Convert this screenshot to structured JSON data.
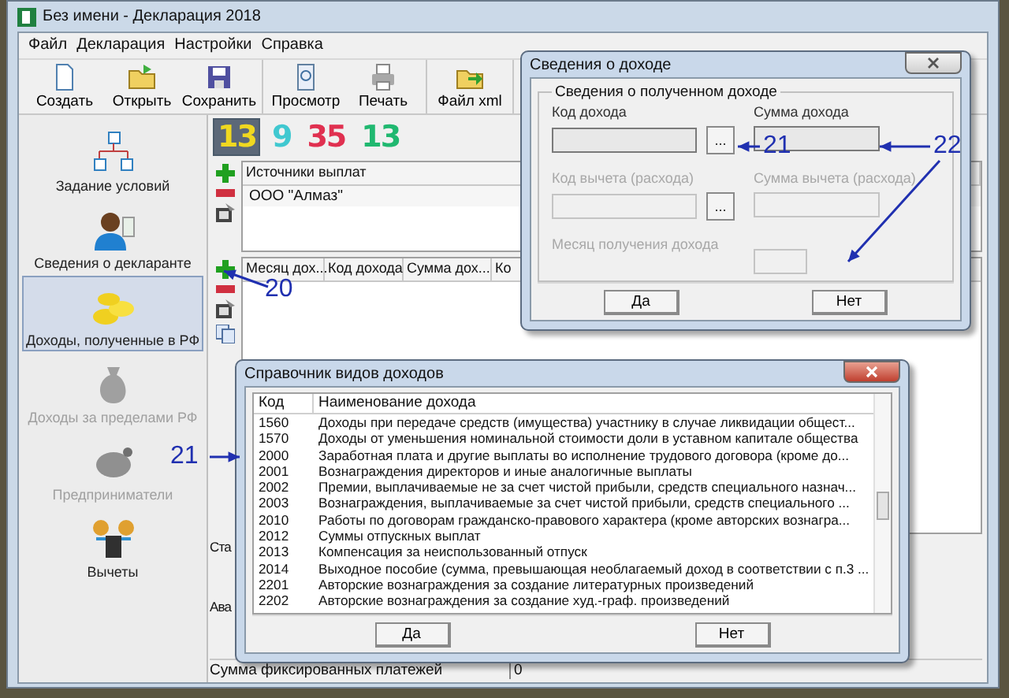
{
  "window": {
    "title": "Без имени - Декларация 2018"
  },
  "menu": [
    "Файл",
    "Декларация",
    "Настройки",
    "Справка"
  ],
  "toolbar": [
    [
      {
        "label": "Создать",
        "kind": "new"
      },
      {
        "label": "Открыть",
        "kind": "open"
      },
      {
        "label": "Сохранить",
        "kind": "save"
      }
    ],
    [
      {
        "label": "Просмотр",
        "kind": "preview"
      },
      {
        "label": "Печать",
        "kind": "print"
      }
    ],
    [
      {
        "label": "Файл xml",
        "kind": "xml"
      }
    ]
  ],
  "counters": [
    {
      "value": "13",
      "color": "#f0d820",
      "selected": true
    },
    {
      "value": "9",
      "color": "#40c8d0",
      "selected": false
    },
    {
      "value": "35",
      "color": "#e03050",
      "selected": false
    },
    {
      "value": "13",
      "color": "#20b870",
      "selected": false
    }
  ],
  "sidebar": [
    {
      "label": "Задание условий",
      "kind": "tree",
      "selected": false,
      "disabled": false
    },
    {
      "label": "Сведения о декларанте",
      "kind": "person",
      "selected": false,
      "disabled": false
    },
    {
      "label": "Доходы, полученные в РФ",
      "kind": "coins",
      "selected": true,
      "disabled": false
    },
    {
      "label": "Доходы за пределами РФ",
      "kind": "moneybag",
      "selected": false,
      "disabled": true
    },
    {
      "label": "Предприниматели",
      "kind": "pig",
      "selected": false,
      "disabled": true
    },
    {
      "label": "Вычеты",
      "kind": "deduction",
      "selected": false,
      "disabled": false
    }
  ],
  "sources": {
    "header": "Источники выплат",
    "rows": [
      "ООО \"Алмаз\""
    ]
  },
  "incomes": {
    "columns": [
      "Месяц дох...",
      "Код дохода",
      "Сумма дох...",
      "Ко"
    ]
  },
  "lower": {
    "group_label": "Ста",
    "label_2": "Ава",
    "fixed_label": "Сумма фиксированных платежей",
    "fixed_value": "0"
  },
  "income_dialog": {
    "title": "Сведения о доходе",
    "group": "Сведения о полученном доходе",
    "fields": [
      {
        "label": "Код дохода",
        "disabled": false,
        "picker": "..."
      },
      {
        "label": "Сумма дохода",
        "disabled": false
      },
      {
        "label": "Код вычета (расхода)",
        "disabled": true,
        "picker": "..."
      },
      {
        "label": "Сумма вычета (расхода)",
        "disabled": true
      },
      {
        "label": "Месяц получения дохода",
        "disabled": true
      }
    ],
    "buttons": [
      "Да",
      "Нет"
    ]
  },
  "reference_dialog": {
    "title": "Справочник видов доходов",
    "columns": [
      "Код",
      "Наименование дохода"
    ],
    "rows": [
      [
        "1560",
        "Доходы при передаче средств (имущества) участнику в случае ликвидации общест..."
      ],
      [
        "1570",
        "Доходы от уменьшения номинальной стоимости доли в уставном капитале общества"
      ],
      [
        "2000",
        "Заработная плата и другие выплаты во исполнение трудового договора (кроме до..."
      ],
      [
        "2001",
        "Вознаграждения директоров и иные аналогичные выплаты"
      ],
      [
        "2002",
        "Премии, выплачиваемые не за счет чистой прибыли, средств специального назнач..."
      ],
      [
        "2003",
        "Вознаграждения, выплачиваемые за счет чистой прибыли, средств специального ..."
      ],
      [
        "2010",
        "Работы по договорам гражданско-правового характера (кроме авторских вознагра..."
      ],
      [
        "2012",
        "Суммы отпускных выплат"
      ],
      [
        "2013",
        "Компенсация за неиспользованный отпуск"
      ],
      [
        "2014",
        "Выходное пособие (сумма, превышающая необлагаемый доход в соответствии с п.3 ..."
      ],
      [
        "2201",
        "Авторские вознаграждения за создание литературных произведений"
      ],
      [
        "2202",
        "Авторские вознаграждения за создание худ.-граф. произведений"
      ]
    ],
    "buttons": [
      "Да",
      "Нет"
    ]
  },
  "annotations": [
    {
      "number": "20"
    },
    {
      "number": "21"
    },
    {
      "number": "21"
    },
    {
      "number": "22"
    }
  ]
}
